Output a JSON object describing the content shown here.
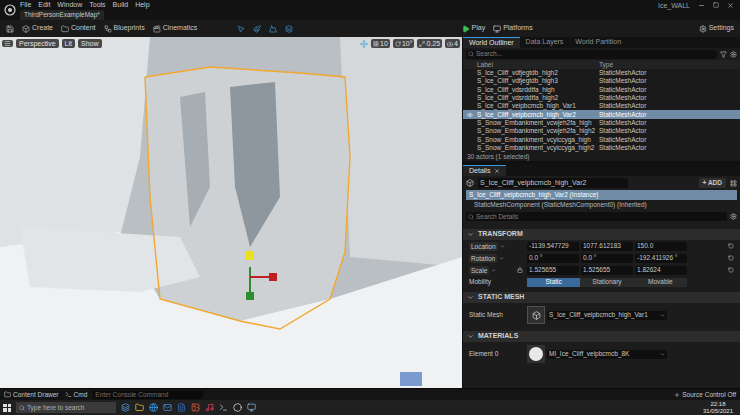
{
  "menu": [
    "File",
    "Edit",
    "Window",
    "Tools",
    "Build",
    "Help"
  ],
  "project_tab": "ThirdPersonExampleMap*",
  "window_title": "Ice_WALL",
  "toolbar": {
    "buttons": [
      "Create",
      "Content",
      "Blueprints",
      "Cinematics"
    ],
    "play": "Play",
    "platforms": "Platforms",
    "settings": "Settings"
  },
  "viewport": {
    "buttons": [
      "Perspective",
      "Lit",
      "Show"
    ],
    "snaps": [
      "10",
      "10°",
      "0.25",
      "4"
    ]
  },
  "outliner": {
    "tabs": [
      {
        "label": "World Outliner",
        "selected": true
      },
      {
        "label": "Data Layers",
        "selected": false
      },
      {
        "label": "World Partition",
        "selected": false
      }
    ],
    "search_placeholder": "Search...",
    "columns": [
      "Label",
      "Type"
    ],
    "rows": [
      {
        "label": "S_Ice_Cliff_vdfjegtdb_high2",
        "type": "StaticMeshActor",
        "selected": false,
        "eye": false
      },
      {
        "label": "S_Ice_Cliff_vdfjegtdb_high3",
        "type": "StaticMeshActor",
        "selected": false,
        "eye": false
      },
      {
        "label": "S_Ice_Cliff_vdsrddtfa_high",
        "type": "StaticMeshActor",
        "selected": false,
        "eye": false
      },
      {
        "label": "S_Ice_Cliff_vdsrddtfa_high2",
        "type": "StaticMeshActor",
        "selected": false,
        "eye": false
      },
      {
        "label": "S_Ice_Cliff_veipbcmcb_high_Var1",
        "type": "StaticMeshActor",
        "selected": false,
        "eye": false
      },
      {
        "label": "S_Ice_Cliff_veipbcmcb_high_Var2",
        "type": "StaticMeshActor",
        "selected": true,
        "eye": true
      },
      {
        "label": "S_Snow_Embankment_vcwjeh2fa_high",
        "type": "StaticMeshActor",
        "selected": false,
        "eye": false
      },
      {
        "label": "S_Snow_Embankment_vcwjeh2fa_high2",
        "type": "StaticMeshActor",
        "selected": false,
        "eye": false
      },
      {
        "label": "S_Snow_Embankment_vcyiccyga_high",
        "type": "StaticMeshActor",
        "selected": false,
        "eye": false
      },
      {
        "label": "S_Snow_Embankment_vcyiccyga_high2",
        "type": "StaticMeshActor",
        "selected": false,
        "eye": false
      }
    ],
    "footer": "30 actors (1 selected)"
  },
  "details": {
    "tab": "Details",
    "name": "S_Ice_Cliff_veipbcmcb_high_Var2",
    "add": "+ ADD",
    "components": [
      {
        "label": "S_Ice_Cliff_veipbcmcb_high_Var2 (Instance)",
        "selected": true
      },
      {
        "label": "StaticMeshComponent (StaticMeshComponent0) (Inherited)",
        "selected": false
      }
    ],
    "search_placeholder": "Search Details",
    "transform": {
      "header": "TRANSFORM",
      "rows": [
        {
          "label": "Location",
          "values": [
            "-1139.547729",
            "1077.612183",
            "150.0"
          ],
          "locked": false
        },
        {
          "label": "Rotation",
          "values": [
            "0.0 °",
            "0.0 °",
            "-192.411926 °"
          ],
          "locked": false
        },
        {
          "label": "Scale",
          "values": [
            "1.525655",
            "1.525655",
            "1.82624"
          ],
          "locked": true
        }
      ],
      "mobility": {
        "label": "Mobility",
        "options": [
          {
            "label": "Static",
            "selected": true
          },
          {
            "label": "Stationary",
            "selected": false
          },
          {
            "label": "Movable",
            "selected": false
          }
        ]
      }
    },
    "static_mesh": {
      "header": "STATIC MESH",
      "label": "Static Mesh",
      "value": "S_Ice_Cliff_veipbcmcb_high_Var1"
    },
    "materials": {
      "header": "MATERIALS",
      "label": "Element 0",
      "value": "MI_Ice_Cliff_veipbcmcb_8K"
    }
  },
  "status_bar": {
    "content_drawer": "Content Drawer",
    "cmd": "Cmd",
    "console_placeholder": "Enter Console Command",
    "source_control": "Source Control Off"
  },
  "taskbar": {
    "search_placeholder": "Type here to search",
    "time": "22:18",
    "date": "31/05/2021"
  }
}
